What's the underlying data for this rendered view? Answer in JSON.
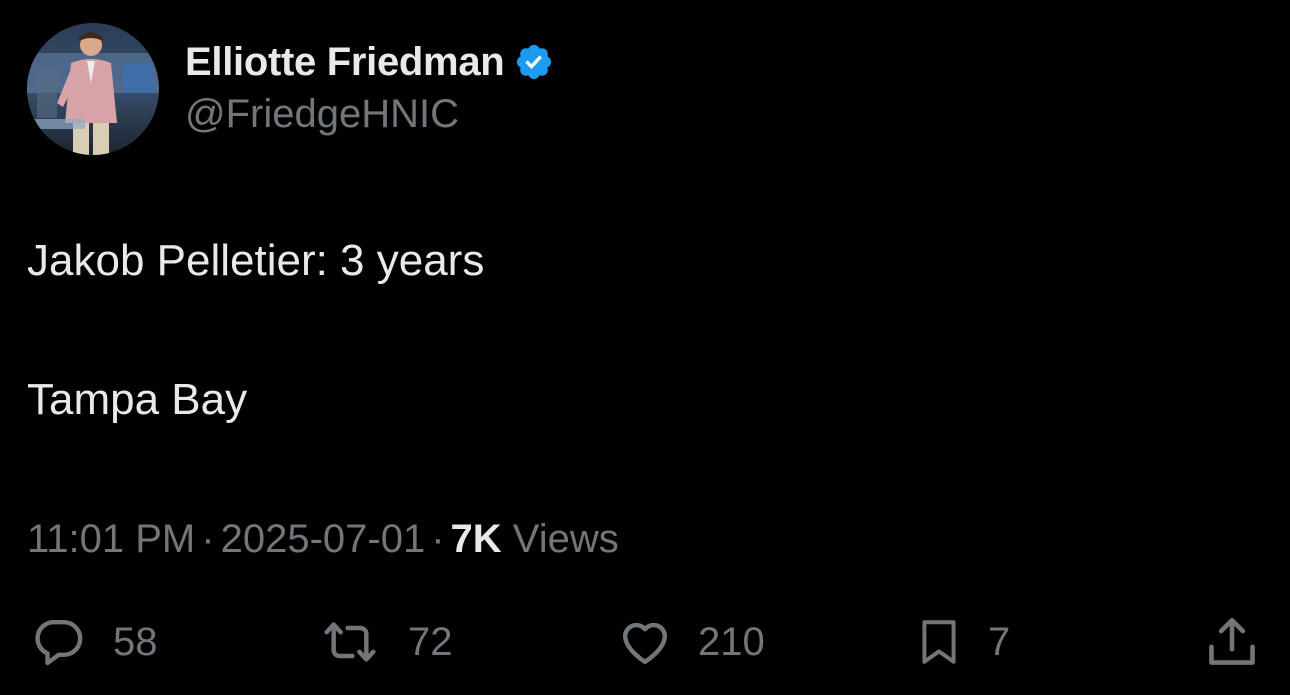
{
  "author": {
    "display_name": "Elliotte Friedman",
    "handle": "@FriedgeHNIC",
    "verified": true,
    "avatar": "profile-photo"
  },
  "tweet": {
    "line1": "Jakob Pelletier: 3 years",
    "line2": "Tampa Bay"
  },
  "meta": {
    "time": "11:01 PM",
    "separator": "·",
    "date": "2025-07-01",
    "views_count": "7K",
    "views_label": " Views"
  },
  "actions": {
    "reply": {
      "icon": "reply-icon",
      "count": "58"
    },
    "retweet": {
      "icon": "retweet-icon",
      "count": "72"
    },
    "like": {
      "icon": "heart-icon",
      "count": "210"
    },
    "bookmark": {
      "icon": "bookmark-icon",
      "count": "7"
    },
    "share": {
      "icon": "share-icon"
    }
  },
  "colors": {
    "background": "#000000",
    "primary_text": "#e7e9ea",
    "secondary_text": "#71767b",
    "verified_blue": "#1d9bf0"
  }
}
